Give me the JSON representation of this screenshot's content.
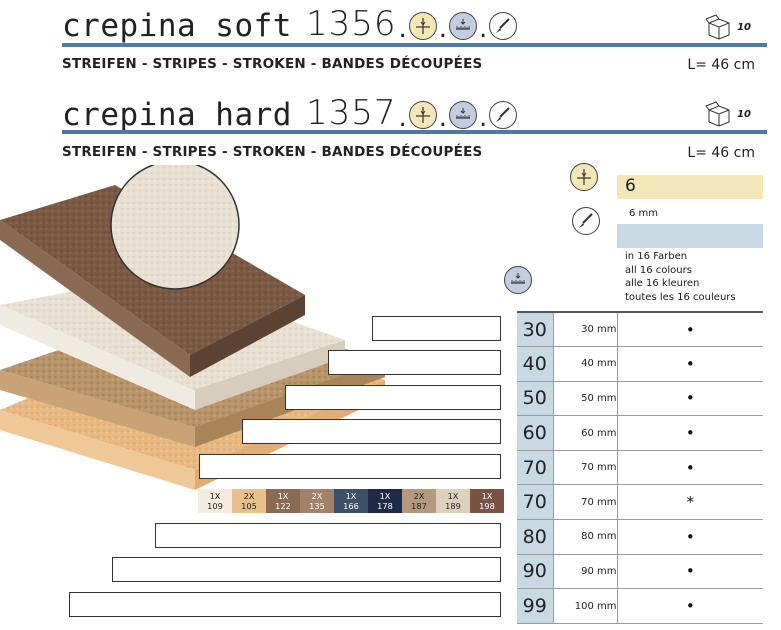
{
  "products": [
    {
      "name": "crepina soft",
      "number": "1356",
      "sep1": ".",
      "sep2": ".",
      "sep3": ".",
      "pack_qty": "10",
      "subtitle": "STREIFEN - STRIPES - STROKEN - BANDES DÉCOUPÉES",
      "length": "L= 46 cm"
    },
    {
      "name": "crepina hard",
      "number": "1357",
      "sep1": ".",
      "sep2": ".",
      "sep3": ".",
      "pack_qty": "10",
      "subtitle": "STREIFEN - STRIPES - STROKEN - BANDES DÉCOUPÉES",
      "length": "L= 46 cm"
    }
  ],
  "specs": {
    "thickness": "6",
    "cut_width": "6 mm",
    "colors_lines": [
      "in 16 Farben",
      "all 16 colours",
      "alle 16 kleuren",
      "toutes les 16 couleurs"
    ]
  },
  "sizes": [
    {
      "big": "30",
      "mm": "30 mm",
      "mark": "•"
    },
    {
      "big": "40",
      "mm": "40 mm",
      "mark": "•"
    },
    {
      "big": "50",
      "mm": "50 mm",
      "mark": "•"
    },
    {
      "big": "60",
      "mm": "60 mm",
      "mark": "•"
    },
    {
      "big": "70",
      "mm": "70 mm",
      "mark": "•"
    },
    {
      "big": "70",
      "mm": "70 mm",
      "mark": "*"
    },
    {
      "big": "80",
      "mm": "80 mm",
      "mark": "•"
    },
    {
      "big": "90",
      "mm": "90 mm",
      "mark": "•"
    },
    {
      "big": "99",
      "mm": "100 mm",
      "mark": "•"
    }
  ],
  "swatches": [
    {
      "qty": "1X",
      "code": "109",
      "color": "#f4ecdf",
      "text": "#222222"
    },
    {
      "qty": "2X",
      "code": "105",
      "color": "#e7c08c",
      "text": "#222222"
    },
    {
      "qty": "1X",
      "code": "122",
      "color": "#8a6a52",
      "text": "#ffffff"
    },
    {
      "qty": "2X",
      "code": "135",
      "color": "#a2806a",
      "text": "#ffffff"
    },
    {
      "qty": "1X",
      "code": "166",
      "color": "#3e5068",
      "text": "#ffffff"
    },
    {
      "qty": "1X",
      "code": "178",
      "color": "#1f2b46",
      "text": "#ffffff"
    },
    {
      "qty": "2X",
      "code": "187",
      "color": "#b39a7e",
      "text": "#222222"
    },
    {
      "qty": "1X",
      "code": "189",
      "color": "#ddd0bd",
      "text": "#222222"
    },
    {
      "qty": "1X",
      "code": "198",
      "color": "#7a5244",
      "text": "#ffffff"
    }
  ],
  "colors": {
    "rule_blue": "#4d7aa8",
    "size_cell_blue": "#c8d9e4",
    "thickness_cream": "#f3e7b8"
  }
}
